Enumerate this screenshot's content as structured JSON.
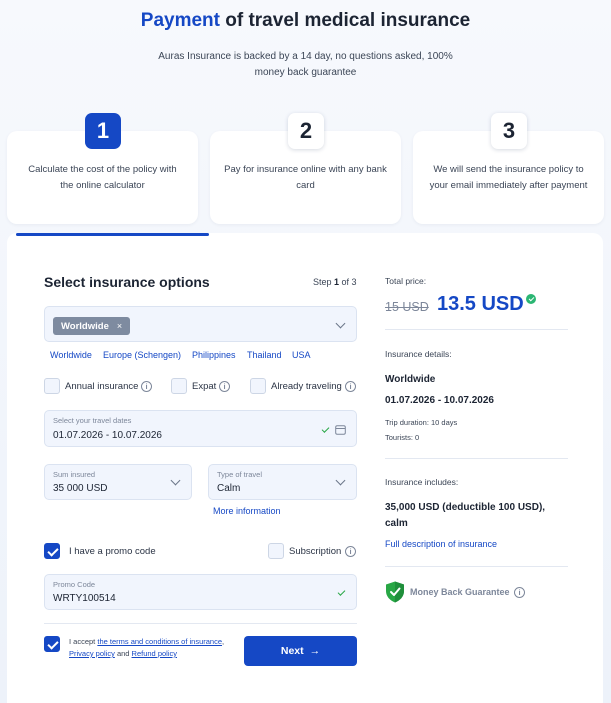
{
  "header": {
    "title_accent": "Payment",
    "title_rest": " of travel medical insurance",
    "subtitle": "Auras Insurance is backed by a 14 day, no questions asked, 100% money back guarantee"
  },
  "steps": [
    {
      "number": "1",
      "text": "Calculate the cost of the policy with the online calculator",
      "active": true
    },
    {
      "number": "2",
      "text": "Pay for insurance online with any bank card",
      "active": false
    },
    {
      "number": "3",
      "text": "We will send the insurance policy to your email immediately after payment",
      "active": false
    }
  ],
  "form": {
    "heading": "Select insurance options",
    "step_prefix": "Step ",
    "step_current": "1",
    "step_suffix": " of 3",
    "destination_chip": "Worldwide",
    "chip_remove": "×",
    "quick_links": [
      "Worldwide",
      "Europe (Schengen)",
      "Philippines",
      "Thailand",
      "USA"
    ],
    "options": [
      {
        "label": "Annual insurance",
        "checked": false
      },
      {
        "label": "Expat",
        "checked": false
      },
      {
        "label": "Already traveling",
        "checked": false
      }
    ],
    "dates": {
      "label": "Select your travel dates",
      "value": "01.07.2026 - 10.07.2026"
    },
    "sum_insured": {
      "label": "Sum insured",
      "value": "35 000 USD"
    },
    "travel_type": {
      "label": "Type of travel",
      "value": "Calm"
    },
    "more_info": "More information",
    "promo_toggle": {
      "label": "I have a promo code",
      "checked": true
    },
    "subscription": {
      "label": "Subscription",
      "checked": false
    },
    "promo": {
      "label": "Promo Code",
      "value": "WRTY100514"
    },
    "accept": {
      "checked": true,
      "prefix": "I accept ",
      "terms": "the terms and conditions of insurance",
      "comma": ",",
      "privacy": "Privacy policy",
      "and": " and ",
      "refund": "Refund policy"
    },
    "next_label": "Next",
    "next_arrow": "→"
  },
  "summary": {
    "total_label": "Total price:",
    "old_price": "15 USD",
    "new_price": "13.5 USD",
    "details_label": "Insurance details:",
    "region": "Worldwide",
    "dates": "01.07.2026 - 10.07.2026",
    "duration": "Trip duration: 10 days",
    "tourists": "Tourists: 0",
    "includes_label": "Insurance includes:",
    "coverage": "35,000 USD (deductible 100 USD), calm",
    "full_description": "Full description of insurance",
    "guarantee": "Money Back Guarantee"
  },
  "icons": {
    "info": "info-icon",
    "chevron": "chevron-down-icon",
    "calendar": "calendar-icon",
    "check": "check-icon",
    "shield": "shield-check-icon"
  },
  "colors": {
    "accent": "#1548c5",
    "success": "#28a745",
    "chip": "#7e8ba0"
  }
}
